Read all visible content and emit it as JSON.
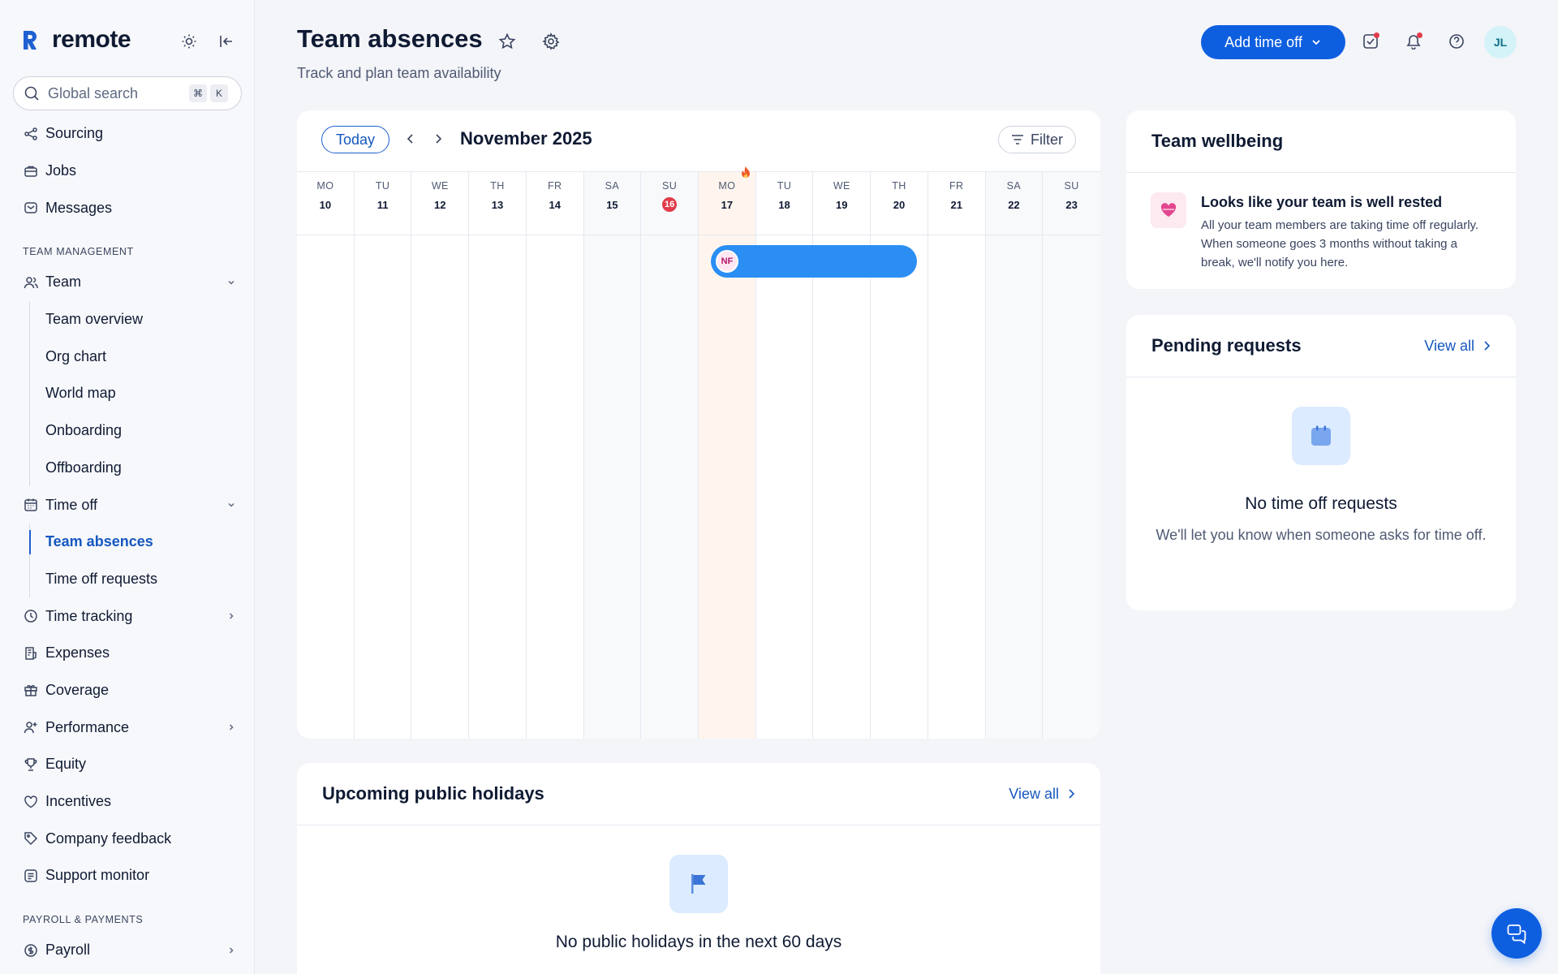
{
  "brand": {
    "name": "remote"
  },
  "search": {
    "placeholder": "Global search",
    "shortcut_mod": "⌘",
    "shortcut_key": "K"
  },
  "sidebar": {
    "items_top": [
      {
        "label": "Sourcing",
        "icon": "share-icon"
      },
      {
        "label": "Jobs",
        "icon": "briefcase-icon"
      },
      {
        "label": "Messages",
        "icon": "message-icon"
      }
    ],
    "section_team": "TEAM MANAGEMENT",
    "team": {
      "label": "Team",
      "icon": "users-icon"
    },
    "team_sub": [
      "Team overview",
      "Org chart",
      "World map",
      "Onboarding",
      "Offboarding"
    ],
    "timeoff": {
      "label": "Time off",
      "icon": "calendar-icon"
    },
    "timeoff_sub": [
      "Team absences",
      "Time off requests"
    ],
    "items_mid": [
      {
        "label": "Time tracking",
        "icon": "clock-icon"
      },
      {
        "label": "Expenses",
        "icon": "receipt-icon"
      },
      {
        "label": "Coverage",
        "icon": "gift-icon"
      },
      {
        "label": "Performance",
        "icon": "user-plus-icon"
      },
      {
        "label": "Equity",
        "icon": "trophy-icon"
      },
      {
        "label": "Incentives",
        "icon": "heart-icon"
      },
      {
        "label": "Company feedback",
        "icon": "tag-icon"
      },
      {
        "label": "Support monitor",
        "icon": "monitor-icon"
      }
    ],
    "section_payroll": "PAYROLL & PAYMENTS",
    "payroll": {
      "label": "Payroll",
      "icon": "dollar-icon"
    }
  },
  "header": {
    "title": "Team absences",
    "subtitle": "Track and plan team availability",
    "add_button": "Add time off",
    "avatar_initials": "JL"
  },
  "calendar": {
    "today_label": "Today",
    "month_label": "November 2025",
    "filter_label": "Filter",
    "days": [
      {
        "name": "MO",
        "num": "10",
        "weekend": false
      },
      {
        "name": "TU",
        "num": "11",
        "weekend": false
      },
      {
        "name": "WE",
        "num": "12",
        "weekend": false
      },
      {
        "name": "TH",
        "num": "13",
        "weekend": false
      },
      {
        "name": "FR",
        "num": "14",
        "weekend": false
      },
      {
        "name": "SA",
        "num": "15",
        "weekend": true
      },
      {
        "name": "SU",
        "num": "16",
        "weekend": true,
        "holiday": true
      },
      {
        "name": "MO",
        "num": "17",
        "weekend": false,
        "today": true
      },
      {
        "name": "TU",
        "num": "18",
        "weekend": false
      },
      {
        "name": "WE",
        "num": "19",
        "weekend": false
      },
      {
        "name": "TH",
        "num": "20",
        "weekend": false
      },
      {
        "name": "FR",
        "num": "21",
        "weekend": false
      },
      {
        "name": "SA",
        "num": "22",
        "weekend": true
      },
      {
        "name": "SU",
        "num": "23",
        "weekend": true
      }
    ],
    "absence": {
      "initials": "NF",
      "color": "#2a8ef3"
    }
  },
  "holidays": {
    "title": "Upcoming public holidays",
    "view_all": "View all",
    "empty_title": "No public holidays in the next 60 days"
  },
  "wellbeing": {
    "title": "Team wellbeing",
    "heading": "Looks like your team is well rested",
    "text": "All your team members are taking time off regularly. When someone goes 3 months without taking a break, we'll notify you here."
  },
  "pending": {
    "title": "Pending requests",
    "view_all": "View all",
    "empty_title": "No time off requests",
    "empty_text": "We'll let you know when someone asks for time off."
  },
  "colors": {
    "accent": "#0e5fe0",
    "link": "#1557c0",
    "today_bg": "#fff5ee",
    "holiday_red": "#e23b4a"
  }
}
